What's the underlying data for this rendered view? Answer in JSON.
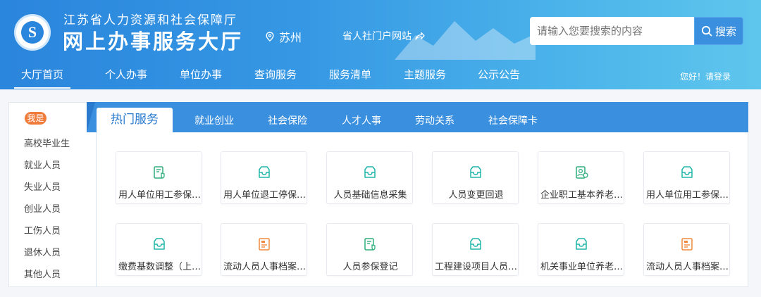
{
  "header": {
    "org_name": "江苏省人力资源和社会保障厅",
    "hall_name": "网上办事服务大厅",
    "location": "苏州",
    "portal_link": "省人社门户网站",
    "search": {
      "placeholder": "请输入您要搜索的内容",
      "button": "搜索"
    },
    "login_text": "您好！请登录",
    "logo_letter": "S",
    "icons": {
      "location": "map-pin-icon",
      "portal": "share-arrow-icon",
      "search": "magnifier-icon",
      "logo": "logo-emblem"
    }
  },
  "nav": {
    "items": [
      {
        "label": "大厅首页",
        "active": true
      },
      {
        "label": "个人办事"
      },
      {
        "label": "单位办事"
      },
      {
        "label": "查询服务"
      },
      {
        "label": "服务清单"
      },
      {
        "label": "主题服务"
      },
      {
        "label": "公示公告"
      }
    ]
  },
  "sidebar": {
    "badge": "我是",
    "items": [
      "高校毕业生",
      "就业人员",
      "失业人员",
      "创业人员",
      "工伤人员",
      "退休人员",
      "其他人员"
    ]
  },
  "tabs": {
    "active": "热门服务",
    "items": [
      "就业创业",
      "社会保险",
      "人才人事",
      "劳动关系",
      "社会保障卡"
    ]
  },
  "services": [
    {
      "label": "用人单位用工参保…",
      "icon": "document-shield-icon",
      "color": "green"
    },
    {
      "label": "用人单位退工停保…",
      "icon": "inbox-icon",
      "color": "teal"
    },
    {
      "label": "人员基础信息采集",
      "icon": "inbox-icon",
      "color": "teal"
    },
    {
      "label": "人员变更回退",
      "icon": "inbox-icon",
      "color": "teal"
    },
    {
      "label": "企业职工基本养老…",
      "icon": "pension-doc-icon",
      "color": "green"
    },
    {
      "label": "用人单位用工参保…",
      "icon": "inbox-icon",
      "color": "teal"
    },
    {
      "label": "缴费基数调整（上…",
      "icon": "inbox-icon",
      "color": "teal"
    },
    {
      "label": "流动人员人事档案…",
      "icon": "archive-card-icon",
      "color": "orange"
    },
    {
      "label": "人员参保登记",
      "icon": "document-shield-icon",
      "color": "green"
    },
    {
      "label": "工程建设项目人员…",
      "icon": "inbox-icon",
      "color": "teal"
    },
    {
      "label": "机关事业单位养老…",
      "icon": "inbox-icon",
      "color": "teal"
    },
    {
      "label": "流动人员人事档案…",
      "icon": "archive-card-icon",
      "color": "orange"
    }
  ],
  "colors": {
    "header_start": "#2a85dc",
    "header_end": "#5ec6ec",
    "tab_bar": "#3a8fde",
    "badge": "#f07c3c",
    "icon_teal": "#1fb5a8",
    "icon_green": "#2fae7c",
    "icon_orange": "#f08a3c"
  }
}
